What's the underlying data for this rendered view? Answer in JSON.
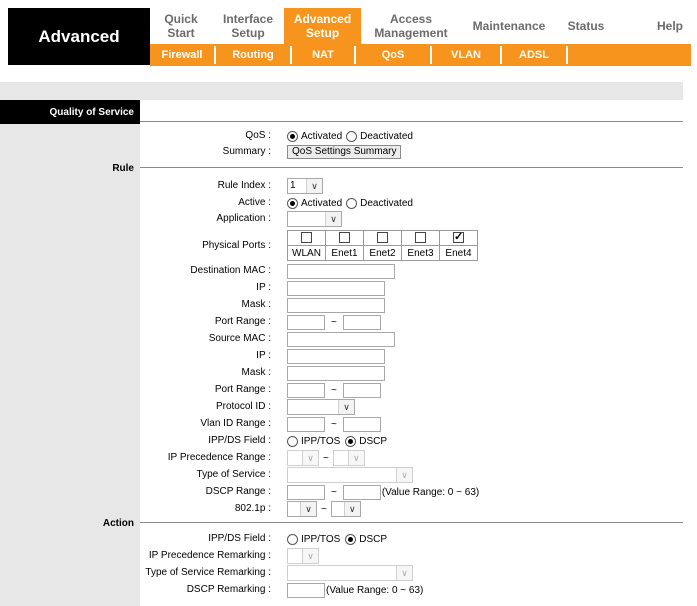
{
  "brand": "Advanced",
  "nav": {
    "quick_start": "Quick Start",
    "interface_setup": "Interface Setup",
    "advanced_setup": "Advanced Setup",
    "access_management": "Access Management",
    "maintenance": "Maintenance",
    "status": "Status",
    "help": "Help"
  },
  "subnav": [
    "Firewall",
    "Routing",
    "NAT",
    "QoS",
    "VLAN",
    "ADSL"
  ],
  "section_title": "Quality of Service",
  "sections": {
    "rule": "Rule",
    "action": "Action"
  },
  "qos": {
    "label": "QoS :",
    "options": [
      "Activated",
      "Deactivated"
    ],
    "selected": "Activated",
    "summary_label": "Summary :",
    "summary_button": "QoS Settings Summary"
  },
  "rule": {
    "rule_index_label": "Rule Index :",
    "rule_index_value": "1",
    "active_label": "Active :",
    "active_options": [
      "Activated",
      "Deactivated"
    ],
    "active_selected": "Activated",
    "application_label": "Application :",
    "application_value": "",
    "physical_ports_label": "Physical Ports :",
    "ports": [
      {
        "name": "WLAN",
        "checked": false
      },
      {
        "name": "Enet1",
        "checked": false
      },
      {
        "name": "Enet2",
        "checked": false
      },
      {
        "name": "Enet3",
        "checked": false
      },
      {
        "name": "Enet4",
        "checked": true
      }
    ],
    "destination_mac_label": "Destination MAC :",
    "ip_label": "IP :",
    "mask_label": "Mask :",
    "port_range_label": "Port Range :",
    "source_mac_label": "Source MAC :",
    "protocol_id_label": "Protocol ID :",
    "vlan_id_range_label": "Vlan ID Range :",
    "ipp_ds_field_label": "IPP/DS Field :",
    "ipp_ds_options": [
      "IPP/TOS",
      "DSCP"
    ],
    "ipp_ds_selected": "DSCP",
    "ip_precedence_range_label": "IP Precedence Range :",
    "type_of_service_label": "Type of Service :",
    "dscp_range_label": "DSCP Range :",
    "dscp_range_hint": "(Value Range: 0 ~ 63)",
    "p8021_label": "802.1p :",
    "tilde": "~"
  },
  "action": {
    "ipp_ds_field_label": "IPP/DS Field :",
    "ipp_ds_options": [
      "IPP/TOS",
      "DSCP"
    ],
    "ipp_ds_selected": "DSCP",
    "ip_precedence_remarking_label": "IP Precedence Remarking :",
    "type_of_service_remarking_label": "Type of Service Remarking :",
    "dscp_remarking_label": "DSCP Remarking :",
    "dscp_remarking_hint": "(Value Range: 0 ~ 63)"
  },
  "colors": {
    "accent": "#f7941d",
    "sidebar": "#e7e7e7",
    "brand_bg": "#000000"
  }
}
